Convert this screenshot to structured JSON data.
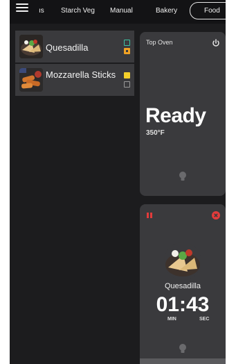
{
  "tabs": [
    "ıs",
    "Starch Veg",
    "Manual",
    "Bakery",
    "Food"
  ],
  "active_tab": "Food",
  "recipes": [
    {
      "name": "Quesadilla",
      "icon": "quesadilla-thumbnail",
      "indicators": [
        "teal-outline",
        "orange-filled"
      ]
    },
    {
      "name": "Mozzarella Sticks",
      "icon": "mozzarella-sticks-thumbnail",
      "indicators": [
        "yellow-filled",
        "gray-outline"
      ]
    }
  ],
  "oven_top": {
    "title": "Top Oven",
    "status": "Ready",
    "temperature": "350°F",
    "icons": [
      "power-icon",
      "bulb-icon"
    ]
  },
  "oven_bottom": {
    "food": "Quesadilla",
    "timer": "01:43",
    "min_label": "MIN",
    "sec_label": "SEC",
    "icons": [
      "pause-icon",
      "cancel-icon",
      "bulb-icon"
    ]
  },
  "colors": {
    "background": "#1c1c1e",
    "card": "#3a3a3d",
    "teal": "#3cc4a4",
    "orange": "#f0a224",
    "yellow": "#f5d02a",
    "red": "#e23b3b"
  }
}
